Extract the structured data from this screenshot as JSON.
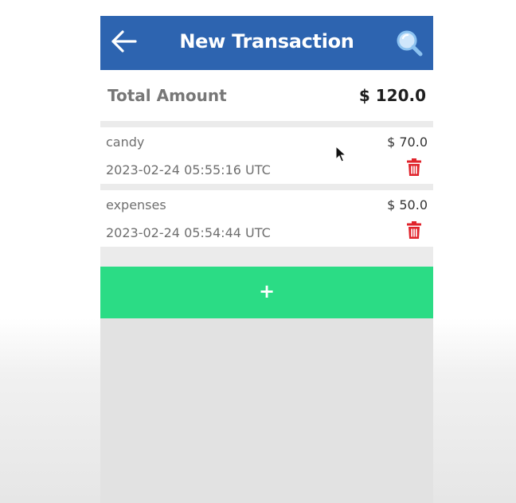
{
  "header": {
    "title": "New Transaction",
    "back_icon": "arrow-left-icon",
    "search_icon": "search-icon",
    "background_color": "#2d64b0"
  },
  "summary": {
    "label": "Total Amount",
    "value": "$ 120.0"
  },
  "transactions": [
    {
      "name": "candy",
      "amount": "$ 70.0",
      "date": "2023-02-24 05:55:16 UTC",
      "action_icon": "trash-icon"
    },
    {
      "name": "expenses",
      "amount": "$ 50.0",
      "date": "2023-02-24 05:54:44 UTC",
      "action_icon": "trash-icon"
    }
  ],
  "add_button": {
    "label": "+",
    "color": "#2bdc85"
  },
  "colors": {
    "delete": "#e0242c",
    "muted_text": "#6f6f6f"
  }
}
